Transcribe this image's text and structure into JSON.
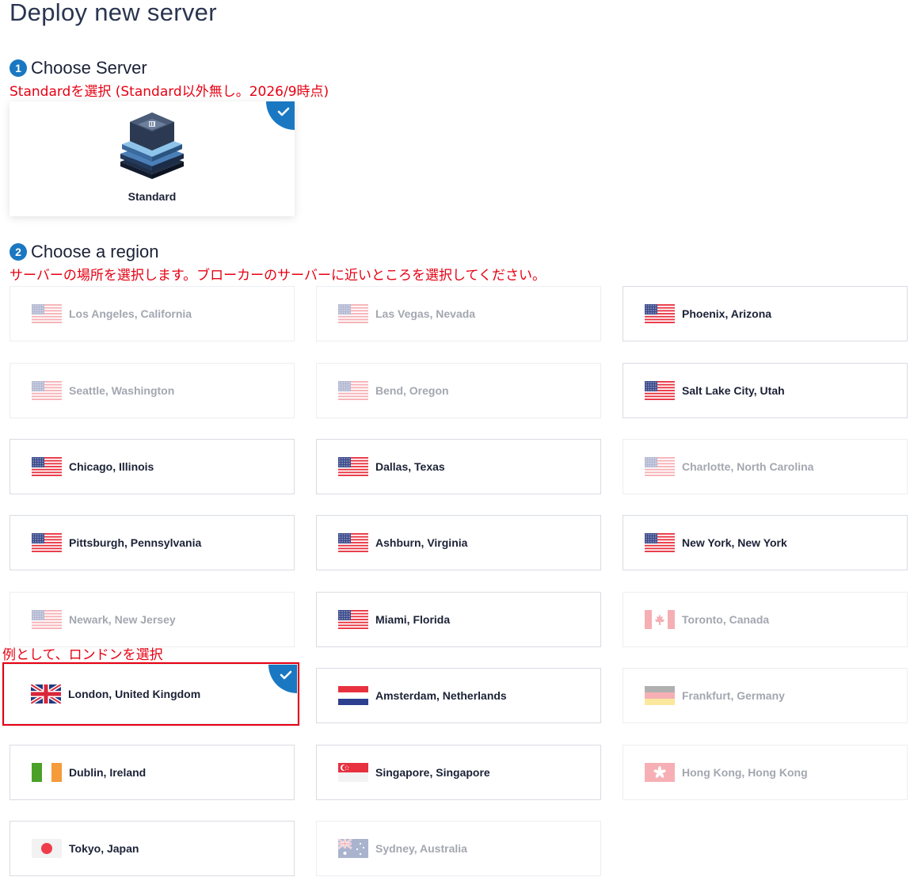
{
  "page": {
    "title": "Deploy new server"
  },
  "steps": [
    {
      "number": "1",
      "label": "Choose Server"
    },
    {
      "number": "2",
      "label": "Choose a region"
    }
  ],
  "notes": {
    "server": "Standardを選択 (Standard以外無し。2026/9時点)",
    "region": "サーバーの場所を選択します。ブローカーのサーバーに近いところを選択してください。",
    "example": "例として、ロンドンを選択"
  },
  "server": {
    "label": "Standard",
    "selected": true
  },
  "colors": {
    "accent": "#1a78c2",
    "annotation": "#e60012"
  },
  "regions": [
    {
      "name": "Los Angeles, California",
      "flag": "us-flag-icon",
      "enabled": false
    },
    {
      "name": "Las Vegas, Nevada",
      "flag": "us-flag-icon",
      "enabled": false
    },
    {
      "name": "Phoenix, Arizona",
      "flag": "us-flag-icon",
      "enabled": true
    },
    {
      "name": "Seattle, Washington",
      "flag": "us-flag-icon",
      "enabled": false
    },
    {
      "name": "Bend, Oregon",
      "flag": "us-flag-icon",
      "enabled": false
    },
    {
      "name": "Salt Lake City, Utah",
      "flag": "us-flag-icon",
      "enabled": true
    },
    {
      "name": "Chicago, Illinois",
      "flag": "us-flag-icon",
      "enabled": true
    },
    {
      "name": "Dallas, Texas",
      "flag": "us-flag-icon",
      "enabled": true
    },
    {
      "name": "Charlotte, North Carolina",
      "flag": "us-flag-icon",
      "enabled": false
    },
    {
      "name": "Pittsburgh, Pennsylvania",
      "flag": "us-flag-icon",
      "enabled": true
    },
    {
      "name": "Ashburn, Virginia",
      "flag": "us-flag-icon",
      "enabled": true
    },
    {
      "name": "New York, New York",
      "flag": "us-flag-icon",
      "enabled": true
    },
    {
      "name": "Newark, New Jersey",
      "flag": "us-flag-icon",
      "enabled": false
    },
    {
      "name": "Miami, Florida",
      "flag": "us-flag-icon",
      "enabled": true
    },
    {
      "name": "Toronto, Canada",
      "flag": "ca-flag-icon",
      "enabled": false
    },
    {
      "name": "London, United Kingdom",
      "flag": "uk-flag-icon",
      "enabled": true,
      "selected": true
    },
    {
      "name": "Amsterdam, Netherlands",
      "flag": "nl-flag-icon",
      "enabled": true
    },
    {
      "name": "Frankfurt, Germany",
      "flag": "de-flag-icon",
      "enabled": false
    },
    {
      "name": "Dublin, Ireland",
      "flag": "ie-flag-icon",
      "enabled": true
    },
    {
      "name": "Singapore, Singapore",
      "flag": "sg-flag-icon",
      "enabled": true
    },
    {
      "name": "Hong Kong, Hong Kong",
      "flag": "hk-flag-icon",
      "enabled": false
    },
    {
      "name": "Tokyo, Japan",
      "flag": "jp-flag-icon",
      "enabled": true
    },
    {
      "name": "Sydney, Australia",
      "flag": "au-flag-icon",
      "enabled": false
    }
  ]
}
